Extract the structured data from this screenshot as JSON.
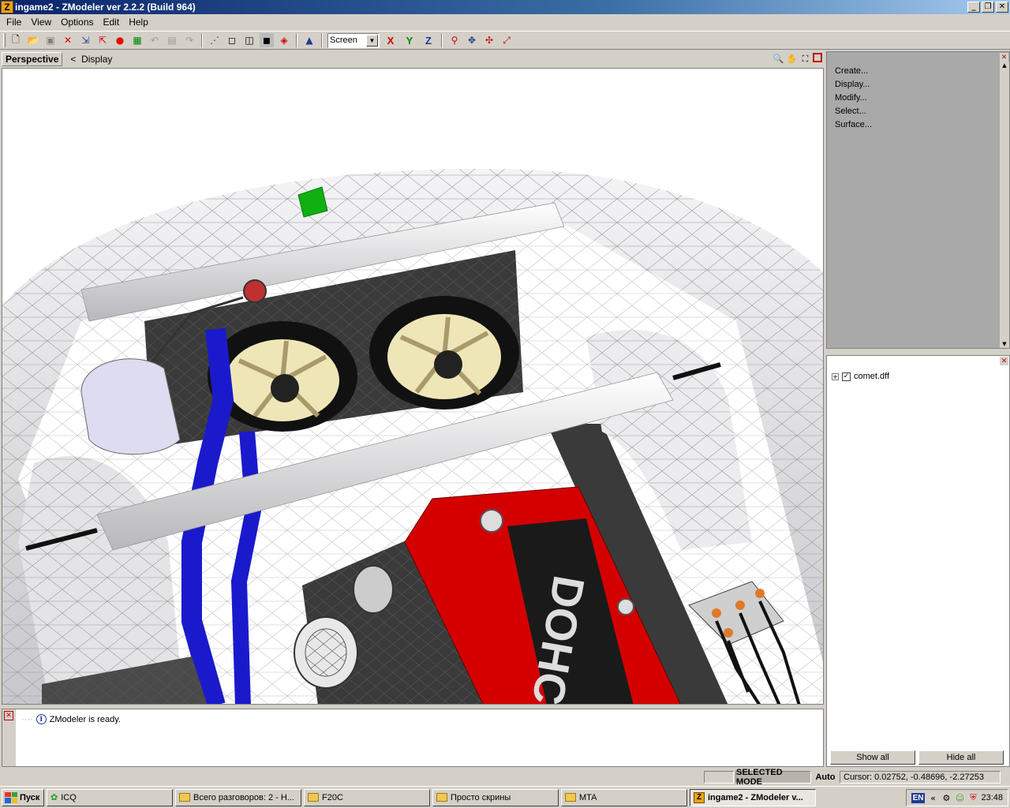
{
  "window": {
    "title": "ingame2 - ZModeler ver 2.2.2 (Build 964)",
    "icon_letter": "Z"
  },
  "menu": [
    "File",
    "View",
    "Options",
    "Edit",
    "Help"
  ],
  "toolbar": {
    "coord_select": "Screen",
    "axes": [
      "X",
      "Y",
      "Z"
    ]
  },
  "viewport": {
    "view_label": "Perspective",
    "display_label": "Display",
    "back_glyph": "<"
  },
  "command_panel": {
    "items": [
      "Create...",
      "Display...",
      "Modify...",
      "Select...",
      "Surface..."
    ]
  },
  "scene_tree": {
    "root_item": "comet.dff",
    "checked": true,
    "show_all_label": "Show all",
    "hide_all_label": "Hide all"
  },
  "log": {
    "message": "ZModeler is ready."
  },
  "statusbar": {
    "mode": "SELECTED MODE",
    "auto": "Auto",
    "cursor": "Cursor: 0.02752, -0.48696, -2.27253"
  },
  "taskbar": {
    "start_label": "Пуск",
    "tasks": [
      {
        "label": "ICQ",
        "icon": "icq-flower-icon"
      },
      {
        "label": "Всего разговоров: 2 - Н...",
        "icon": "folder-icon"
      },
      {
        "label": "F20C",
        "icon": "folder-icon"
      },
      {
        "label": "Просто скрины",
        "icon": "folder-icon"
      },
      {
        "label": "MTA",
        "icon": "folder-icon"
      },
      {
        "label": "ingame2 - ZModeler v...",
        "icon": "zmodeler-icon",
        "active": true
      }
    ],
    "tray": {
      "lang": "EN",
      "time": "23:48"
    }
  },
  "colors": {
    "engine_red": "#d40000",
    "hose_blue": "#1a1acc",
    "marker_green": "#10b010",
    "panel_gray": "#a9a9a9",
    "title_blue": "#0a246a"
  }
}
